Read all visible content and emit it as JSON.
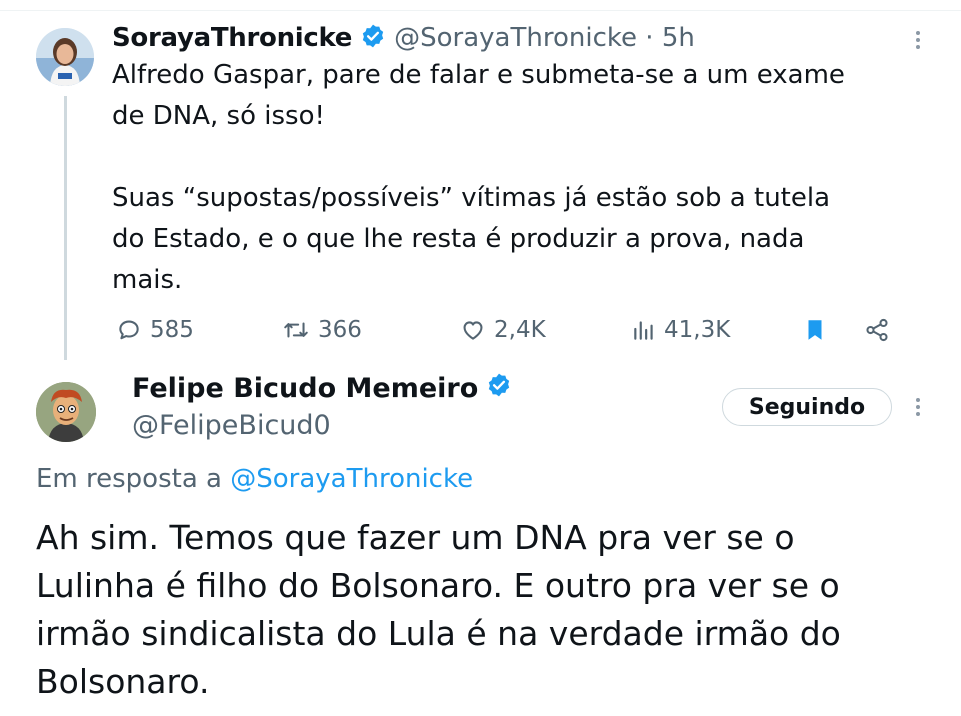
{
  "tweet1": {
    "author_name": "SorayaThronicke",
    "handle": "@SorayaThronicke",
    "separator": "·",
    "time": "5h",
    "lines": [
      "Alfredo Gaspar, pare de falar e submeta-se a um exame",
      "de DNA, só isso!",
      "",
      "Suas “supostas/possíveis” vítimas já estão sob a tutela",
      "do Estado, e o que lhe resta é produzir a prova, nada",
      "mais."
    ],
    "actions": {
      "replies": "585",
      "reposts": "366",
      "likes": "2,4K",
      "views": "41,3K"
    }
  },
  "tweet2": {
    "author_name": "Felipe Bicudo Memeiro",
    "handle": "@FelipeBicud0",
    "follow_label": "Seguindo",
    "reply_prefix": "Em resposta a",
    "reply_mention": "@SorayaThronicke",
    "lines": [
      "Ah sim. Temos que fazer um DNA pra ver se o",
      "Lulinha é filho do Bolsonaro. E outro pra ver se o",
      "irmão sindicalista do Lula é na verdade irmão do",
      "Bolsonaro."
    ]
  },
  "colors": {
    "verified": "#1d9bf0",
    "bookmark_active": "#1d9bf0",
    "secondary_text": "#536471",
    "link": "#1d9bf0",
    "thread_line": "#cfd9de"
  },
  "icons": {
    "verified": "verified-badge-icon",
    "reply": "reply-icon",
    "repost": "repost-icon",
    "like": "heart-icon",
    "views": "views-icon",
    "bookmark": "bookmark-icon",
    "share": "share-icon",
    "more": "more-vertical-icon"
  }
}
